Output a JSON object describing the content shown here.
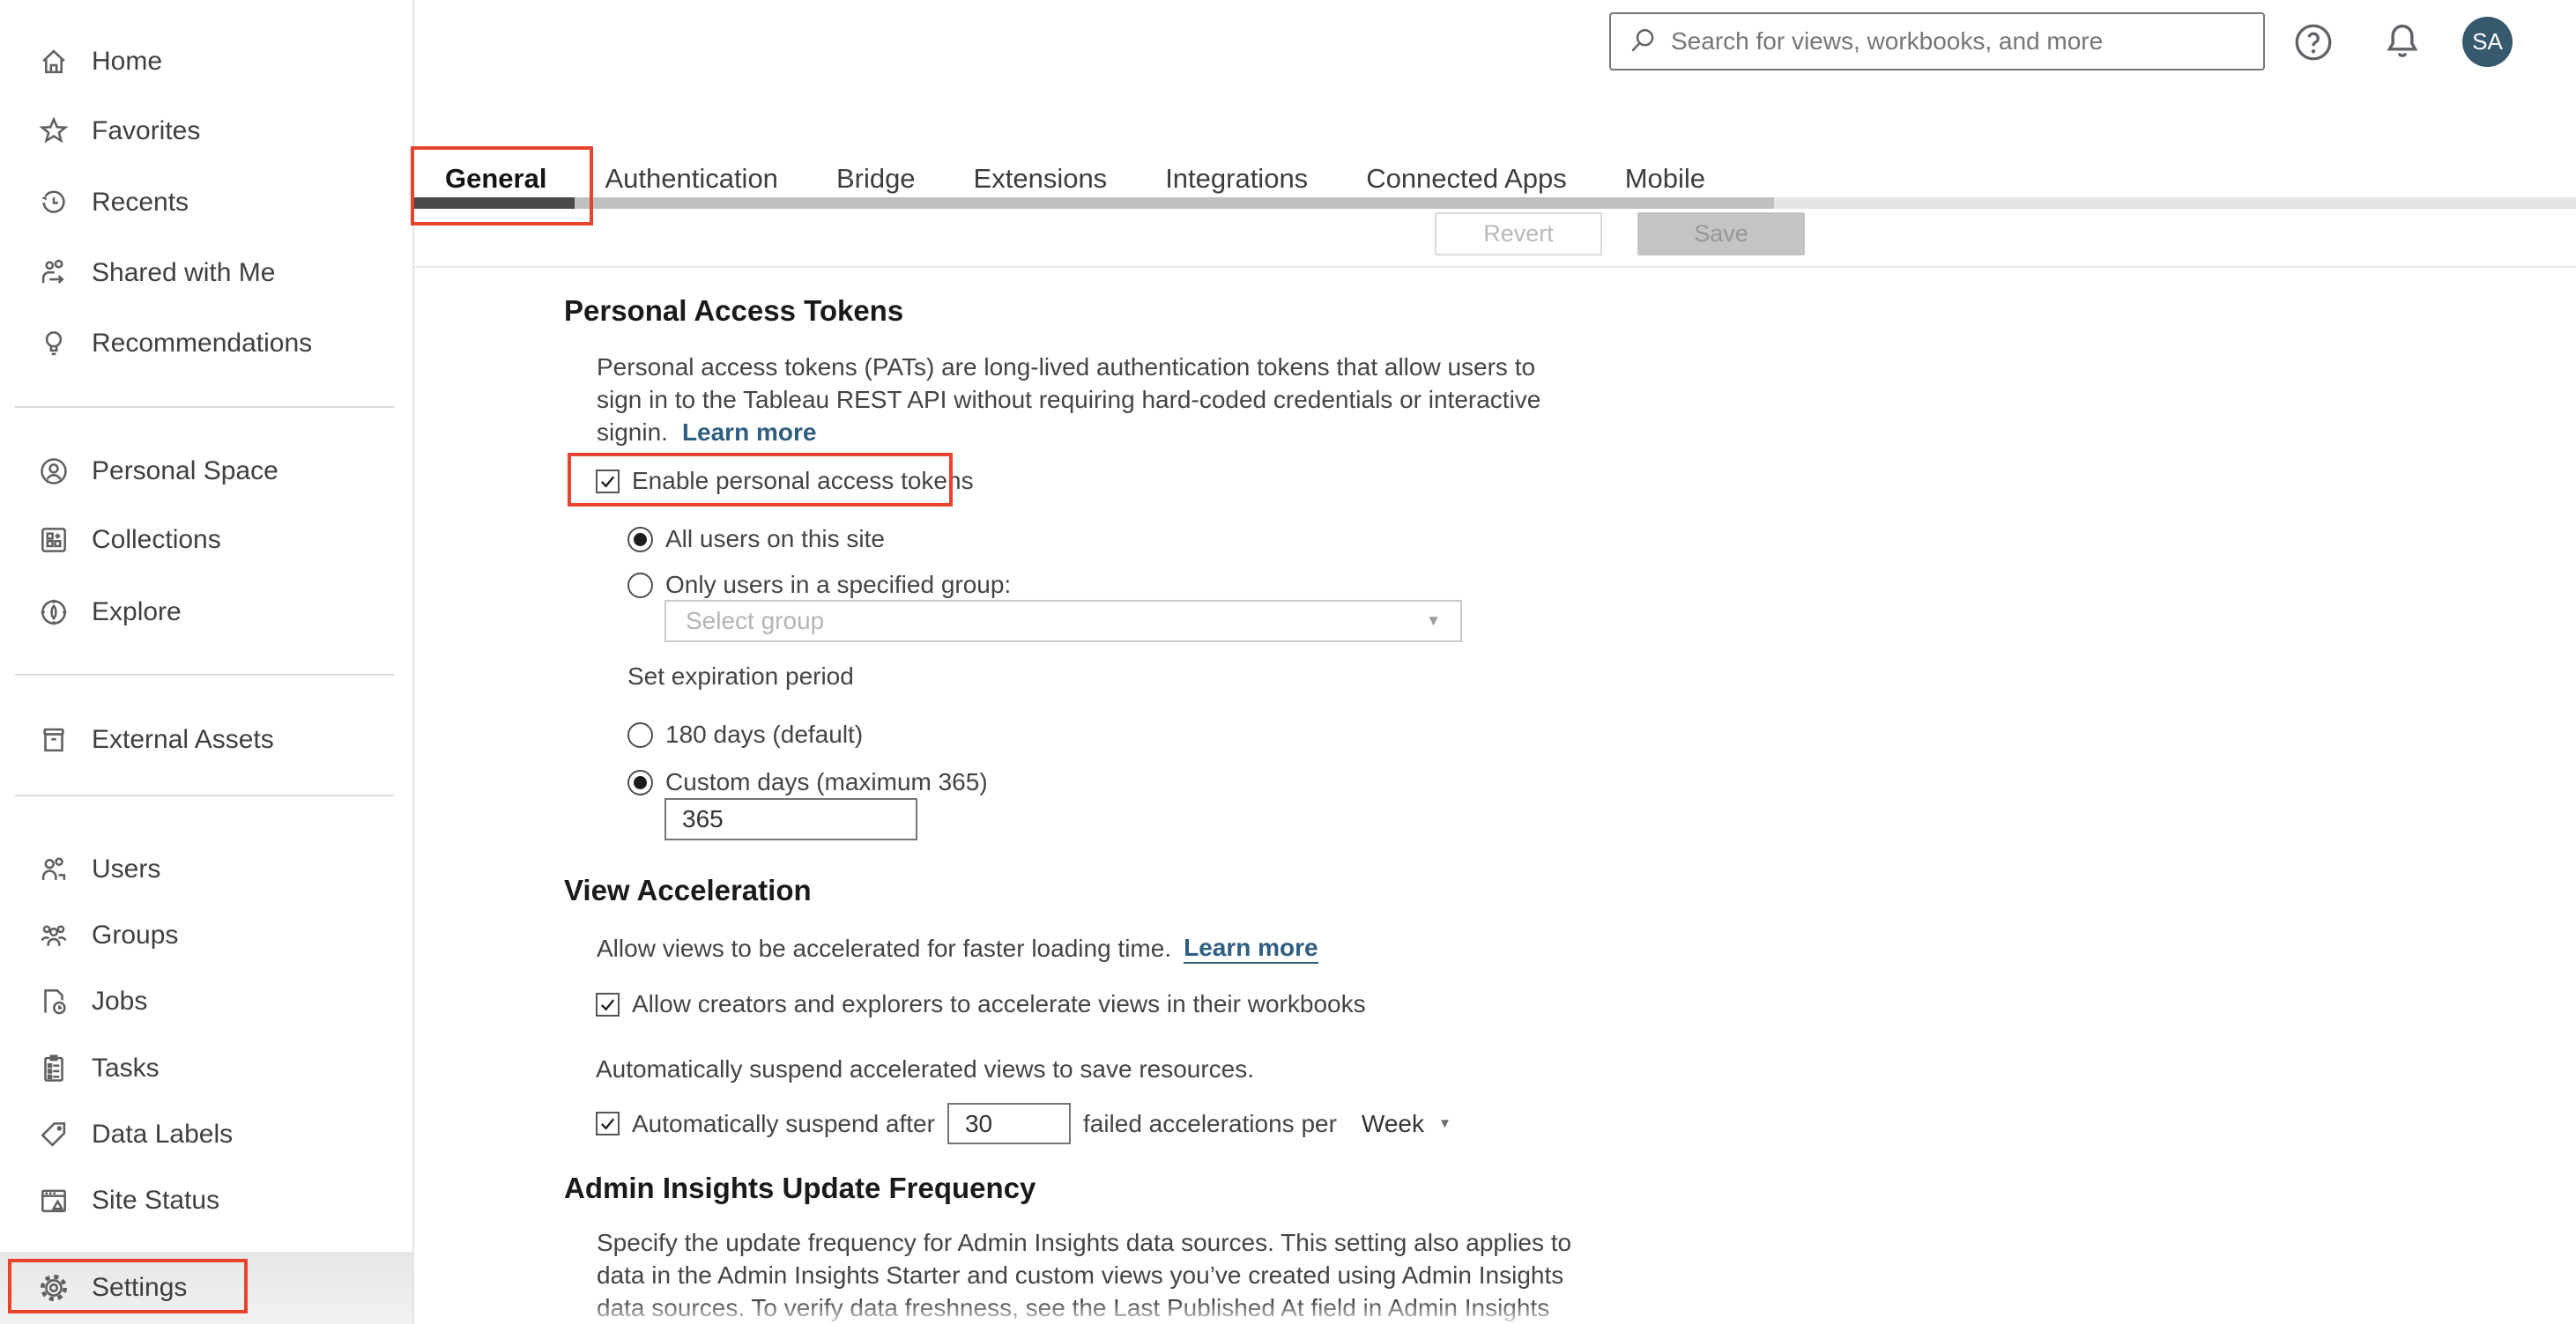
{
  "topbar": {
    "search_placeholder": "Search for views, workbooks, and more",
    "avatar_initials": "SA"
  },
  "tabs": {
    "labels": [
      "General",
      "Authentication",
      "Bridge",
      "Extensions",
      "Integrations",
      "Connected Apps",
      "Mobile"
    ],
    "active": "General",
    "revert_label": "Revert",
    "save_label": "Save"
  },
  "sidebar": {
    "items": [
      "Home",
      "Favorites",
      "Recents",
      "Shared with Me",
      "Recommendations",
      "Personal Space",
      "Collections",
      "Explore",
      "External Assets",
      "Users",
      "Groups",
      "Jobs",
      "Tasks",
      "Data Labels",
      "Site Status",
      "Settings"
    ]
  },
  "pat": {
    "heading": "Personal Access Tokens",
    "desc_line1": "Personal access tokens (PATs) are long-lived authentication tokens that allow users to",
    "desc_line2": "sign in to the Tableau REST API without requiring hard-coded credentials or interactive",
    "desc_line3": "signin.",
    "learn_more": "Learn more",
    "enable_label": "Enable personal access tokens",
    "radio_all_users": "All users on this site",
    "radio_specified_group": "Only users in a specified group:",
    "group_select_placeholder": "Select group",
    "expiration_label": "Set expiration period",
    "radio_180": "180 days (default)",
    "radio_custom": "Custom days (maximum 365)",
    "custom_days_value": "365"
  },
  "view_acceleration": {
    "heading": "View Acceleration",
    "desc": "Allow views to be accelerated for faster loading time.",
    "learn_more": "Learn more",
    "allow_checkbox_label": "Allow creators and explorers to accelerate views in their workbooks",
    "suspend_desc": "Automatically suspend accelerated views to save resources.",
    "suspend_checkbox_label": "Automatically suspend after",
    "suspend_value": "30",
    "suspend_suffix": "failed accelerations per",
    "period_value": "Week"
  },
  "admin_insights": {
    "heading": "Admin Insights Update Frequency",
    "desc_line1": "Specify the update frequency for Admin Insights data sources. This setting also applies to",
    "desc_line2": "data in the Admin Insights Starter and custom views you’ve created using Admin Insights",
    "desc_line3": "data sources. To verify data freshness, see the Last Published At field in Admin Insights"
  },
  "colors": {
    "annotation_red": "#e8432d",
    "link_blue": "#2e5e80",
    "avatar_bg": "#36596e",
    "active_tab_underline": "#4a4a4a"
  }
}
